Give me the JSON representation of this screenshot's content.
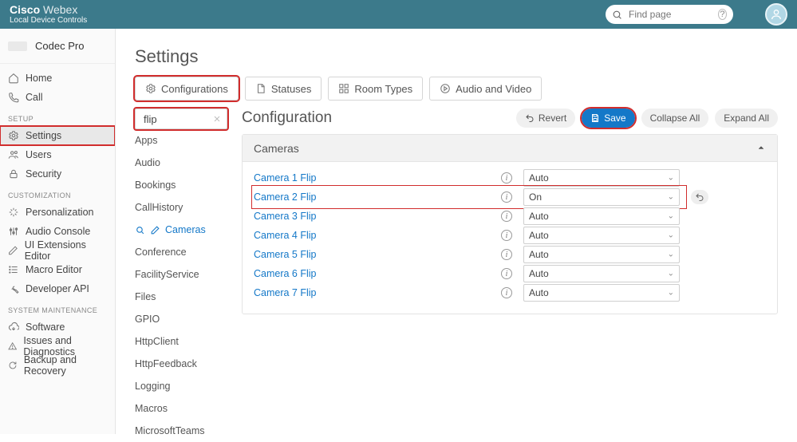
{
  "brand": {
    "cisco": "Cisco",
    "webex": "Webex",
    "subtitle": "Local Device Controls"
  },
  "search": {
    "placeholder": "Find page"
  },
  "device": {
    "name": "Codec Pro"
  },
  "nav": {
    "home": "Home",
    "call": "Call",
    "setup_label": "SETUP",
    "settings": "Settings",
    "users": "Users",
    "security": "Security",
    "custom_label": "CUSTOMIZATION",
    "personalization": "Personalization",
    "audio": "Audio Console",
    "ui": "UI Extensions Editor",
    "macro": "Macro Editor",
    "api": "Developer API",
    "maint_label": "SYSTEM MAINTENANCE",
    "software": "Software",
    "issues": "Issues and Diagnostics",
    "backup": "Backup and Recovery"
  },
  "page": {
    "title": "Settings"
  },
  "tabs": {
    "config": "Configurations",
    "status": "Statuses",
    "rooms": "Room Types",
    "av": "Audio and Video"
  },
  "filter": {
    "value": "flip"
  },
  "facets": [
    "Apps",
    "Audio",
    "Bookings",
    "CallHistory",
    "Cameras",
    "Conference",
    "FacilityService",
    "Files",
    "GPIO",
    "HttpClient",
    "HttpFeedback",
    "Logging",
    "Macros",
    "MicrosoftTeams"
  ],
  "content": {
    "title": "Configuration"
  },
  "actions": {
    "revert": "Revert",
    "save": "Save",
    "collapse": "Collapse All",
    "expand": "Expand All"
  },
  "panel": {
    "title": "Cameras"
  },
  "rows": [
    {
      "name": "Camera 1 Flip",
      "value": "Auto"
    },
    {
      "name": "Camera 2 Flip",
      "value": "On"
    },
    {
      "name": "Camera 3 Flip",
      "value": "Auto"
    },
    {
      "name": "Camera 4 Flip",
      "value": "Auto"
    },
    {
      "name": "Camera 5 Flip",
      "value": "Auto"
    },
    {
      "name": "Camera 6 Flip",
      "value": "Auto"
    },
    {
      "name": "Camera 7 Flip",
      "value": "Auto"
    }
  ]
}
